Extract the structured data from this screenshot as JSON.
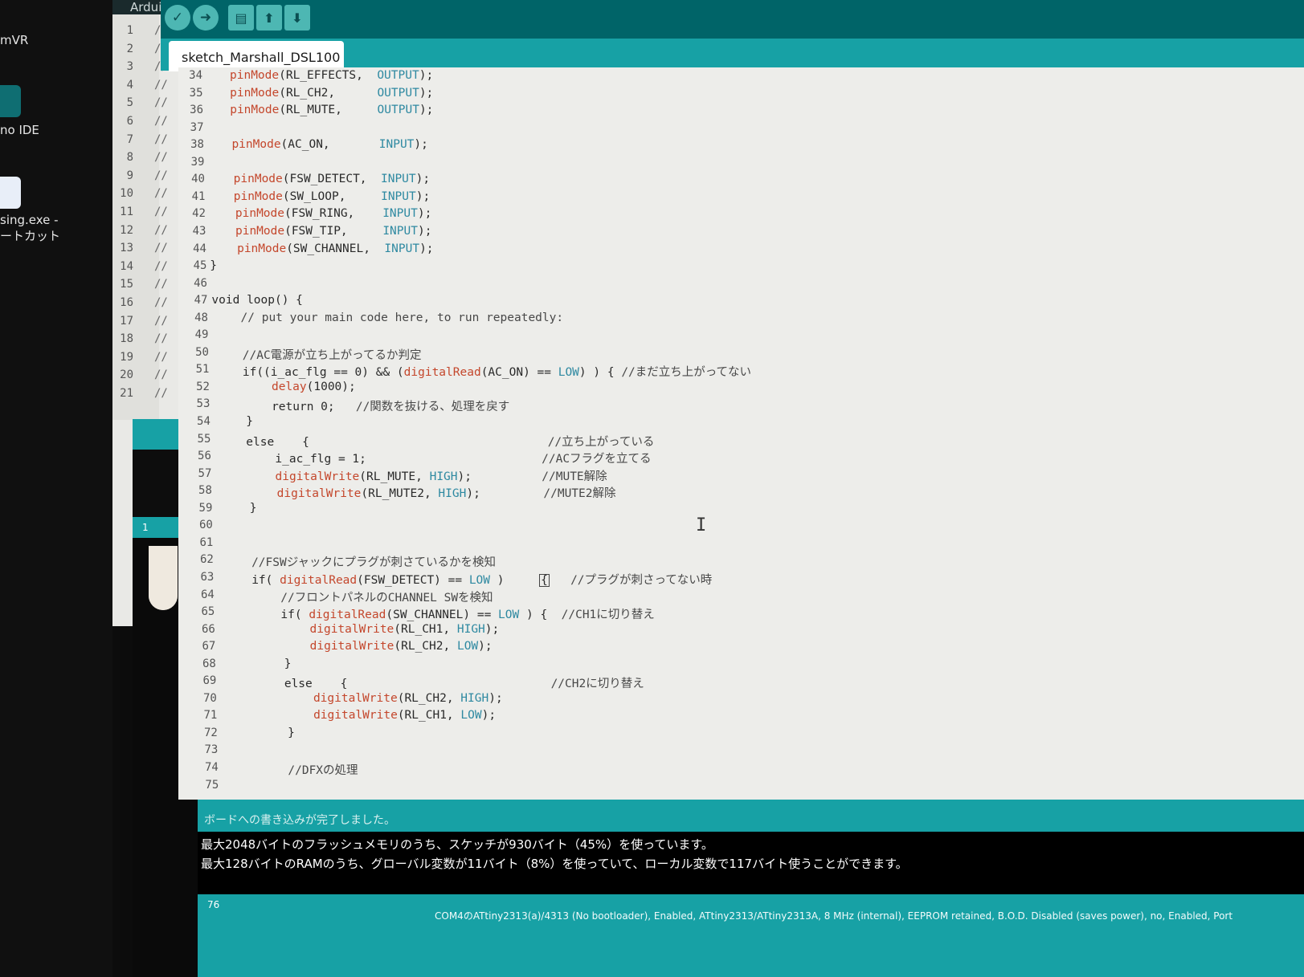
{
  "desktop": {
    "icons": [
      {
        "name": "mVR",
        "label": "mVR"
      },
      {
        "name": "arduino-ide-shortcut",
        "label": "no IDE"
      },
      {
        "name": "processing-shortcut",
        "label_line1": "sing.exe -",
        "label_line2": "ートカット"
      }
    ]
  },
  "background_window": {
    "title": "Ardui",
    "line_numbers": [
      "1",
      "2",
      "3",
      "4",
      "5",
      "6",
      "7",
      "8",
      "9",
      "10",
      "11",
      "12",
      "13",
      "14",
      "15",
      "16",
      "17",
      "18",
      "19",
      "20",
      "21"
    ],
    "code_fragment": "//",
    "status_line": "1"
  },
  "toolbar": {
    "verify_icon": "check-icon",
    "upload_icon": "arrow-right-icon",
    "new_icon": "new-file-icon",
    "open_icon": "arrow-up-icon",
    "save_icon": "arrow-down-icon"
  },
  "tab": {
    "label": "sketch_Marshall_DSL100"
  },
  "editor": {
    "lines": [
      {
        "n": "34",
        "text": "pinMode(RL_EFFECTS,  OUTPUT);"
      },
      {
        "n": "35",
        "text": "pinMode(RL_CH2,      OUTPUT);"
      },
      {
        "n": "36",
        "text": "pinMode(RL_MUTE,     OUTPUT);"
      },
      {
        "n": "37",
        "text": ""
      },
      {
        "n": "38",
        "text": "pinMode(AC_ON,       INPUT);"
      },
      {
        "n": "39",
        "text": ""
      },
      {
        "n": "40",
        "text": "pinMode(FSW_DETECT,  INPUT);"
      },
      {
        "n": "41",
        "text": "pinMode(SW_LOOP,     INPUT);"
      },
      {
        "n": "42",
        "text": "pinMode(FSW_RING,    INPUT);"
      },
      {
        "n": "43",
        "text": "pinMode(FSW_TIP,     INPUT);"
      },
      {
        "n": "44",
        "text": "pinMode(SW_CHANNEL,  INPUT);"
      },
      {
        "n": "45",
        "text": "}"
      },
      {
        "n": "46",
        "text": ""
      },
      {
        "n": "47",
        "text": "void loop() {"
      },
      {
        "n": "48",
        "text": "// put your main code here, to run repeatedly:"
      },
      {
        "n": "49",
        "text": ""
      },
      {
        "n": "50",
        "text": "//AC電源が立ち上がってるか判定"
      },
      {
        "n": "51",
        "text": "if((i_ac_flg == 0) && (digitalRead(AC_ON) == LOW) ) { //まだ立ち上がってない"
      },
      {
        "n": "52",
        "text": "delay(1000);"
      },
      {
        "n": "53",
        "text": "return 0;   //関数を抜ける、処理を戻す"
      },
      {
        "n": "54",
        "text": "}"
      },
      {
        "n": "55",
        "text": "else    {                                  //立ち上がっている"
      },
      {
        "n": "56",
        "text": "i_ac_flg = 1;                         //ACフラグを立てる"
      },
      {
        "n": "57",
        "text": "digitalWrite(RL_MUTE, HIGH);          //MUTE解除"
      },
      {
        "n": "58",
        "text": "digitalWrite(RL_MUTE2, HIGH);         //MUTE2解除"
      },
      {
        "n": "59",
        "text": "}"
      },
      {
        "n": "60",
        "text": ""
      },
      {
        "n": "61",
        "text": ""
      },
      {
        "n": "62",
        "text": "//FSWジャックにプラグが刺さているかを検知"
      },
      {
        "n": "63",
        "text": "if( digitalRead(FSW_DETECT) == LOW )     {   //プラグが刺さってない時"
      },
      {
        "n": "64",
        "text": "//フロントパネルのCHANNEL SWを検知"
      },
      {
        "n": "65",
        "text": "if( digitalRead(SW_CHANNEL) == LOW ) {  //CH1に切り替え"
      },
      {
        "n": "66",
        "text": "digitalWrite(RL_CH1, HIGH);"
      },
      {
        "n": "67",
        "text": "digitalWrite(RL_CH2, LOW);"
      },
      {
        "n": "68",
        "text": "}"
      },
      {
        "n": "69",
        "text": "else    {                             //CH2に切り替え"
      },
      {
        "n": "70",
        "text": "digitalWrite(RL_CH2, HIGH);"
      },
      {
        "n": "71",
        "text": "digitalWrite(RL_CH1, LOW);"
      },
      {
        "n": "72",
        "text": "}"
      },
      {
        "n": "73",
        "text": ""
      },
      {
        "n": "74",
        "text": "//DFXの処理"
      },
      {
        "n": "75",
        "text": ""
      }
    ]
  },
  "status": {
    "message": "ボードへの書き込みが完了しました。"
  },
  "console": {
    "lines": [
      "最大2048バイトのフラッシュメモリのうち、スケッチが930バイト（45%）を使っています。",
      "最大128バイトのRAMのうち、グローバル変数が11バイト（8%）を使っていて、ローカル変数で117バイト使うことができます。"
    ]
  },
  "footer": {
    "line_number": "76",
    "board_info": "COM4のATtiny2313(a)/4313 (No bootloader), Enabled, ATtiny2313/ATtiny2313A, 8 MHz (internal), EEPROM retained, B.O.D. Disabled (saves power), no, Enabled, Port"
  },
  "colors": {
    "toolbar": "#006468",
    "teal": "#17a1a5",
    "keyword": "#c4472c",
    "constant": "#2e89a1",
    "editor_bg": "#ededea"
  }
}
